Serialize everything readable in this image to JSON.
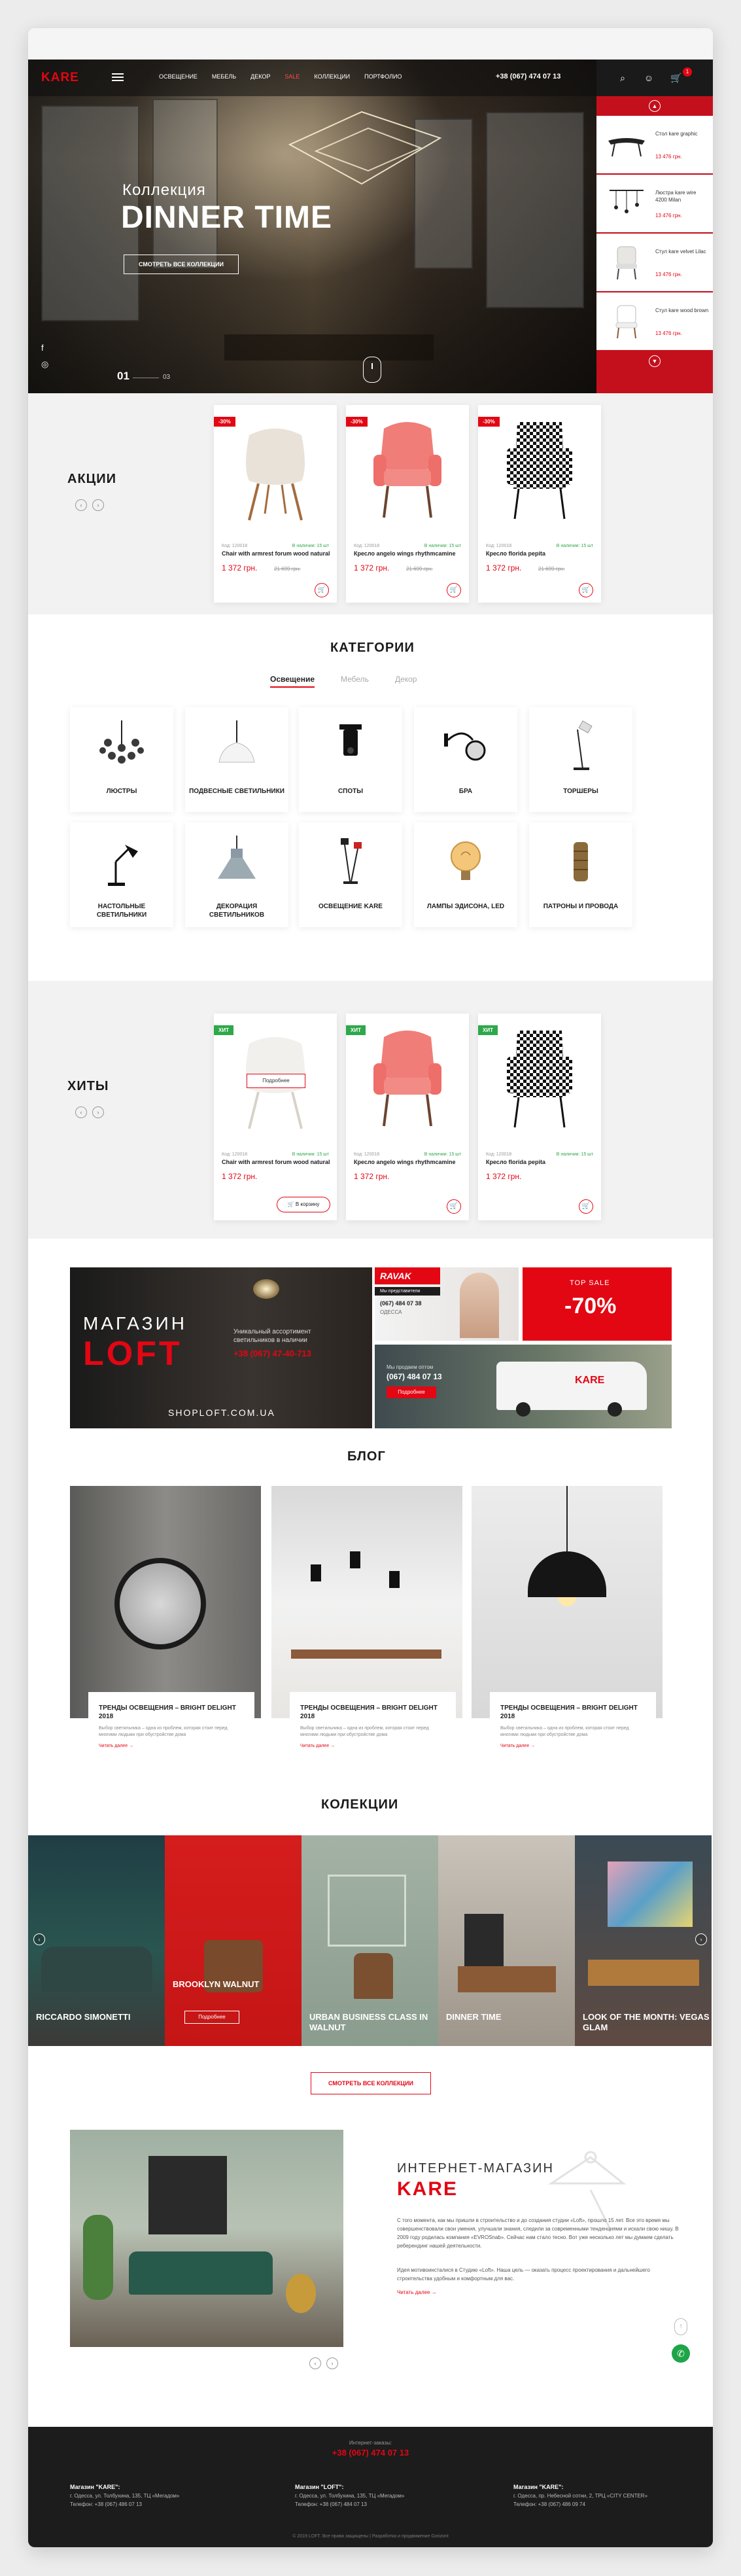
{
  "header": {
    "logo": "KARE",
    "nav": [
      "Освещение",
      "Мебель",
      "Декор",
      "Sale",
      "Коллекции",
      "Портфолио"
    ],
    "active_nav": "Sale",
    "phone": "+38 (067) 474 07 13",
    "cart_count": "1"
  },
  "hero": {
    "subtitle": "Коллекция",
    "title": "DINNER TIME",
    "button": "Смотреть все коллекции",
    "slide_current": "01",
    "slide_total": "03"
  },
  "side_products": [
    {
      "name": "Стол kare graphic",
      "price": "13 476 грн."
    },
    {
      "name": "Люстра kare wire 4200 Milan",
      "price": "13 476 грн."
    },
    {
      "name": "Стул kare velvet Lilac",
      "price": "13 476 грн."
    },
    {
      "name": "Стул kare wood brown",
      "price": "13 476 грн."
    }
  ],
  "sales": {
    "title": "Акции",
    "products": [
      {
        "badge": "-30%",
        "code": "Код: 120018",
        "stock": "В наличии: 15 шт",
        "name": "Chair with armrest forum wood natural",
        "price": "1 372 грн.",
        "old_price": "21 699 грн."
      },
      {
        "badge": "-30%",
        "code": "Код: 120018",
        "stock": "В наличии: 15 шт",
        "name": "Кресло angelo wings rhythmcamine",
        "price": "1 372 грн.",
        "old_price": "21 699 грн."
      },
      {
        "badge": "-30%",
        "code": "Код: 120018",
        "stock": "В наличии: 15 шт",
        "name": "Кресло florida pepita",
        "price": "1 372 грн.",
        "old_price": "21 699 грн."
      }
    ]
  },
  "categories": {
    "title": "Категории",
    "tabs": [
      "Освещение",
      "Мебель",
      "Декор"
    ],
    "items": [
      "Люстры",
      "Подвесные светильники",
      "Споты",
      "Бра",
      "Торшеры",
      "Настольные светильники",
      "Декорация светильников",
      "Освещение Kare",
      "Лампы эдисона, LED",
      "Патроны и провода"
    ]
  },
  "hits": {
    "title": "Хиты",
    "badge": "ХИТ",
    "quick_view": "Подробнее",
    "cart_button": "В корзину",
    "products": [
      {
        "code": "Код: 120018",
        "stock": "В наличии: 15 шт",
        "name": "Chair with armrest forum wood natural",
        "price": "1 372 грн."
      },
      {
        "code": "Код: 120018",
        "stock": "В наличии: 15 шт",
        "name": "Кресло angelo wings rhythmcamine",
        "price": "1 372 грн."
      },
      {
        "code": "Код: 120018",
        "stock": "В наличии: 15 шт",
        "name": "Кресло florida pepita",
        "price": "1 372 грн."
      }
    ]
  },
  "promo": {
    "loft_shop": "МАГАЗИН",
    "loft_brand": "LOFT",
    "loft_text": "Уникальный ассортимент светильников в наличии",
    "loft_phone": "+38 (067) 47-40-713",
    "loft_site": "SHOPLOFT.COM.UA",
    "ravak_logo": "RAVAK",
    "ravak_tag": "Мы представители",
    "ravak_phone": "(067) 484 07 38",
    "ravak_city": "ОДЕССА",
    "sale_label": "TOP SALE",
    "sale_value": "-70%",
    "truck_text": "Мы продаем оптом",
    "truck_phone": "(067) 484 07 13",
    "truck_btn": "Подробнее",
    "truck_logo": "KARE"
  },
  "blog": {
    "title": "Блог",
    "posts": [
      {
        "title": "Тренды освещения – bright delight 2018",
        "desc": "Выбор светильника – одна из проблем, которая стоит перед многими людьми при обустройстве дома",
        "more": "Читать далее"
      },
      {
        "title": "Тренды освещения – bright delight 2018",
        "desc": "Выбор светильника – одна из проблем, которая стоит перед многими людьми при обустройстве дома",
        "more": "Читать далее"
      },
      {
        "title": "Тренды освещения – bright delight 2018",
        "desc": "Выбор светильника – одна из проблем, которая стоит перед многими людьми при обустройстве дома",
        "more": "Читать далее"
      }
    ]
  },
  "collections": {
    "title": "Колекции",
    "items": [
      "Riccardo Simonetti",
      "Brooklyn Walnut",
      "Urban Business Class in Walnut",
      "Dinner Time",
      "Look of the Month: Vegas Glam"
    ],
    "item_button": "Подробнее",
    "all_button": "Смотреть все коллекции"
  },
  "about": {
    "title": "Интернет-магазин",
    "brand": "KARE",
    "p1": "С того момента, как мы пришли в строительство и до создания студии «Loft», прошло 15 лет. Все это время мы совершенствовали свои умения, улучшали знания, следили за современными тенденциями и искали свою нишу. В 2009 году родилась компания «EVROSnab». Сейчас нам стало тесно. Вот уже несколько лет мы думаем сделать реберендинг нашей деятельности.",
    "p2": "Идея мотивоинсталися в Студию «Loft». Наша цель — оказать процесс проектирования и дальнейшего строительства удобным и комфортным для вас.",
    "more": "Читать далее"
  },
  "footer": {
    "order_label": "Интернет-заказы:",
    "phone": "+38 (067) 474 07 13",
    "cols": [
      {
        "title": "Магазин \"KARE\":",
        "line1": "г. Одесса, ул. Толбухина, 135, ТЦ «Мегадом»",
        "line2": "Телефон: +38 (067) 486 07 13"
      },
      {
        "title": "Магазин \"LOFT\":",
        "line1": "г. Одесса, ул. Толбухина, 135, ТЦ «Мегадом»",
        "line2": "Телефон: +38 (067) 484 07 13"
      },
      {
        "title": "Магазин \"KARE\":",
        "line1": "г. Одесса, пр. Небесной сотни, 2, ТРЦ «CITY CENTER»",
        "line2": "Телефон: +38 (067) 486 09 74"
      }
    ],
    "copyright": "© 2019 LOFT. Все права защищены | Разработка и продвижение Gorizont"
  },
  "colors": {
    "brand_red": "#e30613",
    "green_badge": "#2ea84a",
    "dark": "#1c1c1c"
  }
}
